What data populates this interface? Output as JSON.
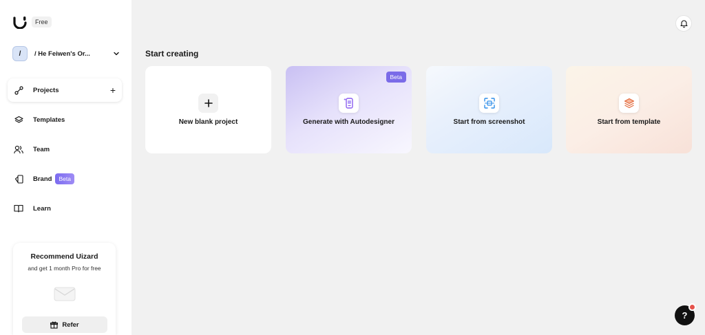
{
  "sidebar": {
    "plan_badge": "Free",
    "org": {
      "avatar_text": "/",
      "name": "/ He Feiwen's Or..."
    },
    "nav": [
      {
        "label": "Projects",
        "icon": "projects-icon",
        "active": true
      },
      {
        "label": "Templates",
        "icon": "layers-icon"
      },
      {
        "label": "Team",
        "icon": "team-icon"
      },
      {
        "label": "Brand",
        "icon": "brand-icon",
        "badge": "Beta"
      },
      {
        "label": "Learn",
        "icon": "book-icon"
      }
    ],
    "refer": {
      "title": "Recommend Uizard",
      "subtitle": "and get 1 month Pro for free",
      "button_label": "Refer"
    }
  },
  "main": {
    "section_title": "Start creating",
    "cards": [
      {
        "label": "New blank project",
        "icon": "plus-icon"
      },
      {
        "label": "Generate with Autodesigner",
        "icon": "autodesigner-icon",
        "badge": "Beta"
      },
      {
        "label": "Start from screenshot",
        "icon": "screenshot-icon"
      },
      {
        "label": "Start from template",
        "icon": "template-stack-icon"
      }
    ]
  },
  "help": {
    "label": "?"
  },
  "colors": {
    "accent": "#7a6be8",
    "background": "#f1f1f1",
    "notification": "#e5534b"
  }
}
